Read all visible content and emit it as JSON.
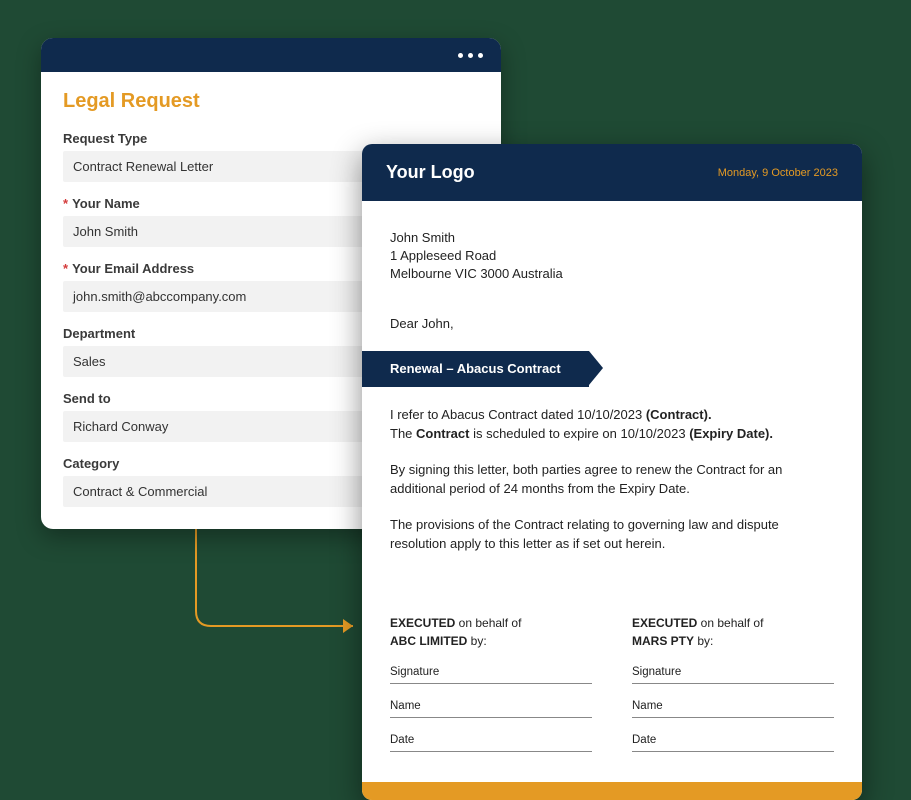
{
  "form": {
    "title": "Legal Request",
    "fields": {
      "request_type": {
        "label": "Request Type",
        "value": "Contract Renewal Letter",
        "required": false
      },
      "your_name": {
        "label": "Your Name",
        "value": "John Smith",
        "required": true
      },
      "your_email": {
        "label": "Your Email Address",
        "value": "john.smith@abccompany.com",
        "required": true
      },
      "department": {
        "label": "Department",
        "value": "Sales",
        "required": false
      },
      "send_to": {
        "label": "Send to",
        "value": "Richard Conway",
        "required": false
      },
      "category": {
        "label": "Category",
        "value": "Contract & Commercial",
        "required": false
      }
    }
  },
  "letter": {
    "logo_text": "Your Logo",
    "date": "Monday, 9 October 2023",
    "recipient": {
      "name": "John Smith",
      "line1": "1 Appleseed Road",
      "line2": "Melbourne VIC 3000 Australia"
    },
    "greeting": "Dear John,",
    "subject": "Renewal – Abacus Contract",
    "body": {
      "p1_a": "I refer to Abacus Contract dated 10/10/2023 ",
      "p1_b": "(Contract).",
      "p1_c": "The ",
      "p1_d": "Contract",
      "p1_e": " is scheduled to expire on 10/10/2023 ",
      "p1_f": "(Expiry Date).",
      "p2": "By signing this letter, both parties agree to renew the Contract for an additional period of 24 months from the Expiry Date.",
      "p3": "The provisions of the Contract relating to governing law and dispute resolution apply to this letter as if set out herein."
    },
    "signatures": {
      "left": {
        "executed": "EXECUTED",
        "on_behalf": " on behalf of",
        "party": "ABC LIMITED",
        "by": " by:"
      },
      "right": {
        "executed": "EXECUTED",
        "on_behalf": " on behalf of",
        "party": "MARS PTY",
        "by": " by:"
      },
      "labels": {
        "signature": "Signature",
        "name": "Name",
        "date": "Date"
      }
    }
  }
}
